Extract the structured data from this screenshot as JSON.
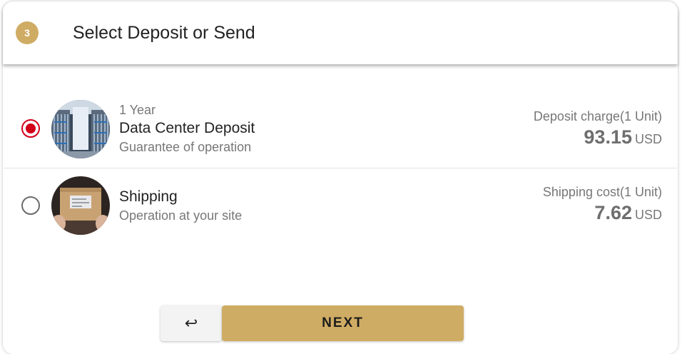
{
  "colors": {
    "accent": "#cfac63",
    "selected_radio": "#d3001a"
  },
  "header": {
    "step_number": "3",
    "title": "Select Deposit or Send"
  },
  "options": [
    {
      "selected": true,
      "image_icon": "server-racks-image",
      "kicker": "1 Year",
      "title": "Data Center Deposit",
      "subtitle": "Guarantee of operation",
      "price_label": "Deposit charge(1 Unit)",
      "price_value": "93.15",
      "price_currency": "USD"
    },
    {
      "selected": false,
      "image_icon": "package-box-image",
      "title": "Shipping",
      "subtitle": "Operation at your site",
      "price_label": "Shipping cost(1 Unit)",
      "price_value": "7.62",
      "price_currency": "USD"
    }
  ],
  "actions": {
    "back_icon": "return-arrow-icon",
    "back_glyph": "↩",
    "next_label": "NEXT"
  }
}
